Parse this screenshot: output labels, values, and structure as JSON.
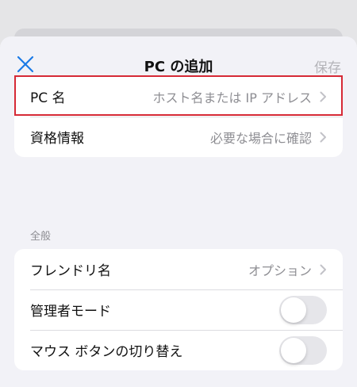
{
  "nav": {
    "title": "PC の追加",
    "save_label": "保存"
  },
  "connection": {
    "pc_name": {
      "label": "PC 名",
      "placeholder": "ホスト名または IP アドレス"
    },
    "credentials": {
      "label": "資格情報",
      "value": "必要な場合に確認"
    }
  },
  "general": {
    "header": "全般",
    "friendly_name": {
      "label": "フレンドリ名",
      "value": "オプション"
    },
    "admin_mode": {
      "label": "管理者モード",
      "on": false
    },
    "swap_mouse": {
      "label": "マウス ボタンの切り替え",
      "on": false
    }
  },
  "colors": {
    "accent": "#1a7ae6",
    "highlight": "#d62a36"
  },
  "icons": [
    "close-icon",
    "chevron-right-icon"
  ]
}
